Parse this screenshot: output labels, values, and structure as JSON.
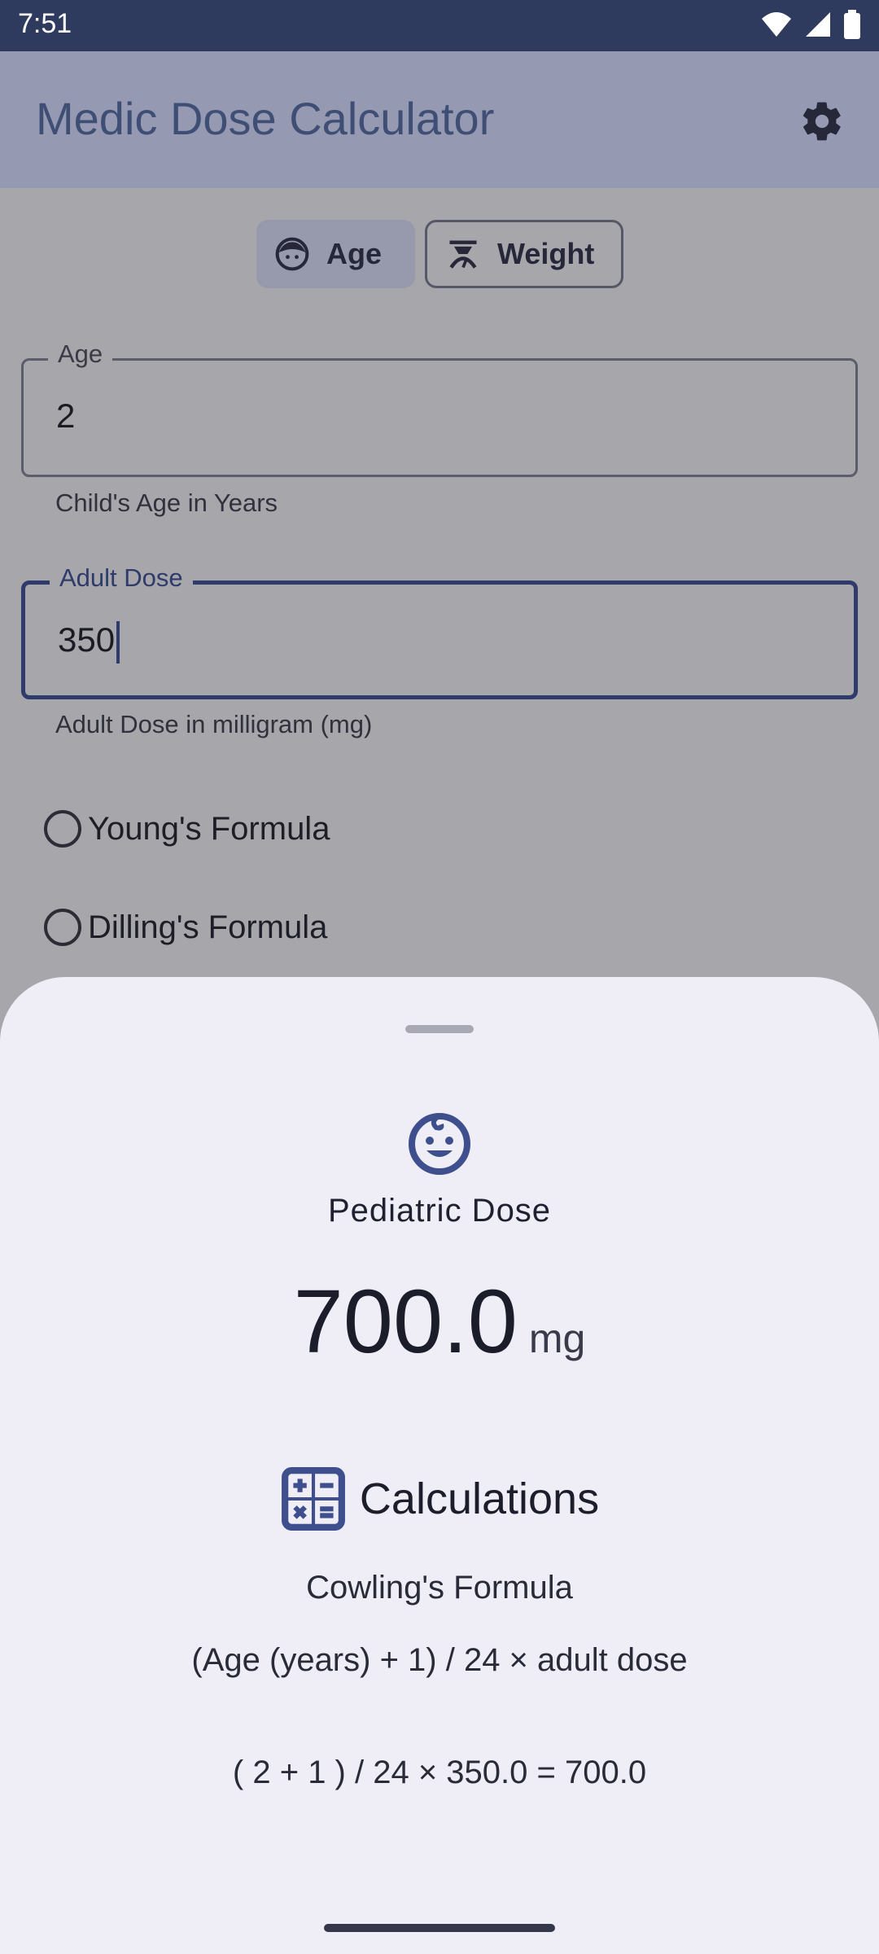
{
  "status_bar": {
    "time": "7:51"
  },
  "app_bar": {
    "title": "Medic Dose Calculator",
    "settings_icon": "gear-icon"
  },
  "toggle": {
    "age_label": "Age",
    "weight_label": "Weight",
    "selected": "Age"
  },
  "age_field": {
    "label": "Age",
    "value": "2",
    "helper": "Child's Age in Years"
  },
  "dose_field": {
    "label": "Adult Dose",
    "value": "350",
    "helper": "Adult Dose in milligram (mg)"
  },
  "formulas": [
    {
      "label": "Young's Formula",
      "selected": false
    },
    {
      "label": "Dilling's Formula",
      "selected": false
    }
  ],
  "result_sheet": {
    "icon": "baby-face-icon",
    "title": "Pediatric Dose",
    "dose_value": "700.0",
    "dose_unit": "mg",
    "calc_title": "Calculations",
    "formula_name": "Cowling's Formula",
    "formula": "(Age (years) + 1) / 24 × adult dose",
    "computation": "( 2 + 1 ) / 24 × 350.0 = 700.0"
  },
  "colors": {
    "status_bar": "#2f3b5e",
    "app_bar": "#9599b2",
    "accent": "#3f4e8c",
    "scrim_background": "#a7a6aa",
    "sheet": "#efeef6"
  }
}
